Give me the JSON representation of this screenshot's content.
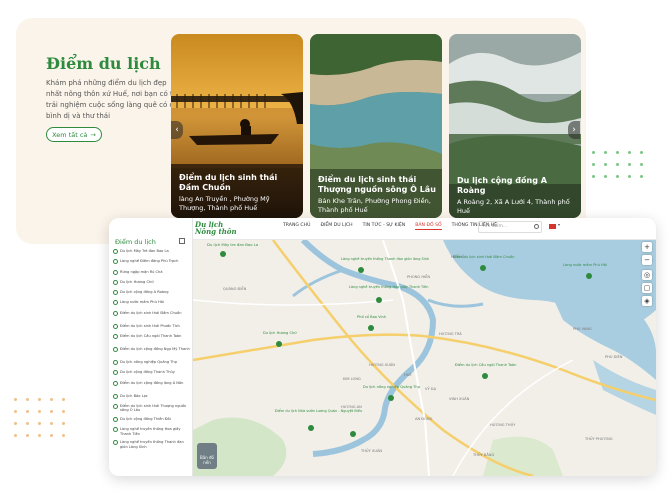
{
  "promo": {
    "title": "Điểm du lịch",
    "description": "Khám phá những điểm du lịch đẹp nhất nông thôn xứ Huế, nơi bạn có thể trải nghiệm cuộc sống làng quê có đỏ bình dị và thư thái",
    "view_all_label": "Xem tất cả",
    "arrow_icon": "→"
  },
  "destinations": [
    {
      "name": "Điểm du lịch sinh thái Đầm Chuồn",
      "location": "làng An Truyền , Phường Mỹ Thượng, Thành phố Huế"
    },
    {
      "name": "Điểm du lịch sinh thái Thượng nguồn sông Ô Lâu",
      "location": "Bản Khe Trăn, Phường Phong Điền, Thành phố Huế"
    },
    {
      "name": "Du lịch cộng đồng A Roàng",
      "location": "A Roàng 2, Xã A Lưới 4, Thành phố Huế"
    }
  ],
  "carousel": {
    "prev_icon": "‹",
    "next_icon": "›"
  },
  "app": {
    "logo_line1": "Du lịch",
    "logo_line2": "Nông thôn",
    "nav": [
      "TRANG CHỦ",
      "ĐIỂM DU LỊCH",
      "TIN TỨC - SỰ KIỆN",
      "BẢN ĐỒ SỐ",
      "THÔNG TIN LIÊN HỆ"
    ],
    "active_nav": "BẢN ĐỒ SỐ",
    "search_placeholder": "Tìm kiếm...",
    "sidebar_title": "Điểm du lịch",
    "sidebar_items": [
      "Du lịch Mây Tré đan Bao La",
      "Làng nghề Điêm đăng Phú Trạch",
      "Rừng ngập mặn Rú Chá",
      "Du lịch Hương Chữ",
      "Du lịch cộng đồng A Roàng",
      "Làng nước mắm Phú Hải",
      "Điểm du lịch sinh thái Đầm Chuồn",
      "Điểm du lịch sinh thái Phước Tích",
      "Điểm du lịch Cầu ngói Thanh Toàn",
      "Điểm du lịch cộng đồng Ngự Mỹ Thanh",
      "Du lịch nông nghiệp Quảng Thọ",
      "Du lịch cộng đồng Thanh Thủy",
      "Điểm du lịch cộng đồng làng Á Nôn",
      "Du lịch Bảo Lạc",
      "Điểm du lịch sinh thái Thượng nguồn sông Ô Lâu",
      "Du lịch cộng đồng Thiền Đôi",
      "Làng nghề truyền thống Hoa giấy Thanh Tiên",
      "Làng nghề truyền thống Thanh đan giòn Làng Sình"
    ],
    "map_markers": [
      "Du lịch Mây tre đan Bao La",
      "Làng nghề truyền thống Thanh đan giòn làng Sình",
      "Điểm du lịch sinh thái Đầm Chuồn",
      "Làng nước mắm Phú Hải",
      "Làng nghề truyền thống Hoa giấy Thanh Tiên",
      "Phố cổ Bao Vinh",
      "Du lịch Hương Chữ",
      "Điểm du lịch Cầu ngói Thanh Toàn",
      "Du lịch nông nghiệp Quảng Thọ",
      "Điểm du lịch Nhà vườn Lương Quán - Nguyệt Biều"
    ],
    "map_places": [
      "HIỀN SĨ",
      "QUẢNG ĐIỀN",
      "PHONG HIỀN",
      "HƯƠNG TRÀ",
      "HƯƠNG XUÂN",
      "HUẾ",
      "PHÚ VANG",
      "PHÚ DIÊN",
      "HƯƠNG THỦY",
      "THỦY BẰNG",
      "VINH XUÂN",
      "KIM LONG",
      "THỦY PHƯƠNG",
      "HƯƠNG AN",
      "VỸ DẠ",
      "AN ĐÔNG",
      "THỦY XUÂN"
    ],
    "map_controls": [
      "+",
      "−"
    ],
    "minimap_label": "Bản đồ nền"
  },
  "colors": {
    "brand_green": "#2e8b3e",
    "active_red": "#d6352c",
    "water": "#a9cde0",
    "land": "#f2efe9"
  }
}
